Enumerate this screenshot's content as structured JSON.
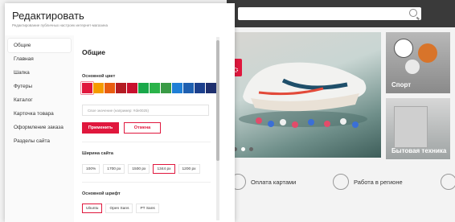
{
  "panel": {
    "title": "Редактировать",
    "subtitle": "Редактирование публичных настроек интернет-магазина"
  },
  "sidebar": {
    "items": [
      {
        "label": "Общие"
      },
      {
        "label": "Главная"
      },
      {
        "label": "Шапка"
      },
      {
        "label": "Футеры"
      },
      {
        "label": "Каталог"
      },
      {
        "label": "Карточка товара"
      },
      {
        "label": "Оформление заказа"
      },
      {
        "label": "Разделы сайта"
      }
    ]
  },
  "content": {
    "heading": "Общие",
    "main_color": {
      "label": "Основной цвет",
      "swatches": [
        "#e0173d",
        "#f59b00",
        "#e85d10",
        "#b31c23",
        "#c8102e",
        "#1aa84a",
        "#2bb34a",
        "#3a9b46",
        "#1f7fd6",
        "#1e5fb0",
        "#1b3f8c",
        "#1e2f6e"
      ],
      "selected_index": 0,
      "custom_placeholder": "Свое значение (например: #de0025)",
      "apply_label": "Применить",
      "cancel_label": "Отмена"
    },
    "site_width": {
      "label": "Ширина сайта",
      "options": [
        "100%",
        "1700 px",
        "1500 px",
        "1344 px",
        "1200 px"
      ],
      "selected": "1344 px"
    },
    "main_font": {
      "label": "Основной шрифт",
      "options": [
        "Ubuntu",
        "Open Sans",
        "PT Sans"
      ],
      "selected": "Ubuntu"
    }
  },
  "store": {
    "cards": [
      {
        "label": "Спорт"
      },
      {
        "label": "Бытовая техника"
      }
    ],
    "services": [
      {
        "label": "Оплата картами"
      },
      {
        "label": "Работа в регионе"
      }
    ]
  },
  "colors": {
    "accent": "#e0173d"
  }
}
